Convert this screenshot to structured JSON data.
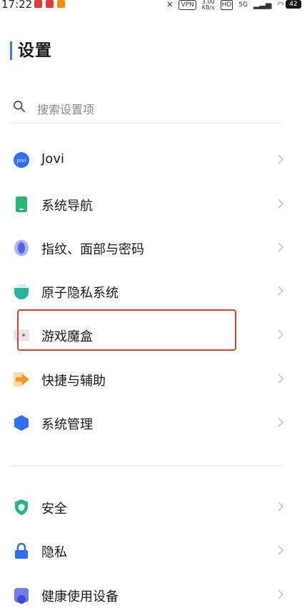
{
  "status_bar": {
    "time": "17:22",
    "network_speed": "3.00\nKB/s",
    "hd": "HD",
    "signal_5g": "5G",
    "battery": "42",
    "vpn": "VPN"
  },
  "header": {
    "title": "设置"
  },
  "search": {
    "placeholder": "搜索设置项",
    "icon": "search-icon"
  },
  "group1": [
    {
      "label": "Jovi",
      "icon": "jovi-icon"
    },
    {
      "label": "系统导航",
      "icon": "phone-navigation-icon"
    },
    {
      "label": "指纹、面部与密码",
      "icon": "fingerprint-icon"
    },
    {
      "label": "原子隐私系统",
      "icon": "privacy-shield-icon"
    },
    {
      "label": "游戏魔盒",
      "icon": "game-box-icon"
    },
    {
      "label": "快捷与辅助",
      "icon": "shortcut-arrow-icon"
    },
    {
      "label": "系统管理",
      "icon": "system-hexagon-icon"
    }
  ],
  "group2": [
    {
      "label": "安全",
      "icon": "security-shield-icon"
    },
    {
      "label": "隐私",
      "icon": "lock-icon"
    },
    {
      "label": "健康使用设备",
      "icon": "health-icon"
    }
  ],
  "colors": {
    "accent": "#3d7bf7",
    "highlight_border": "#e0432b",
    "chevron": "#c4c4c4"
  }
}
